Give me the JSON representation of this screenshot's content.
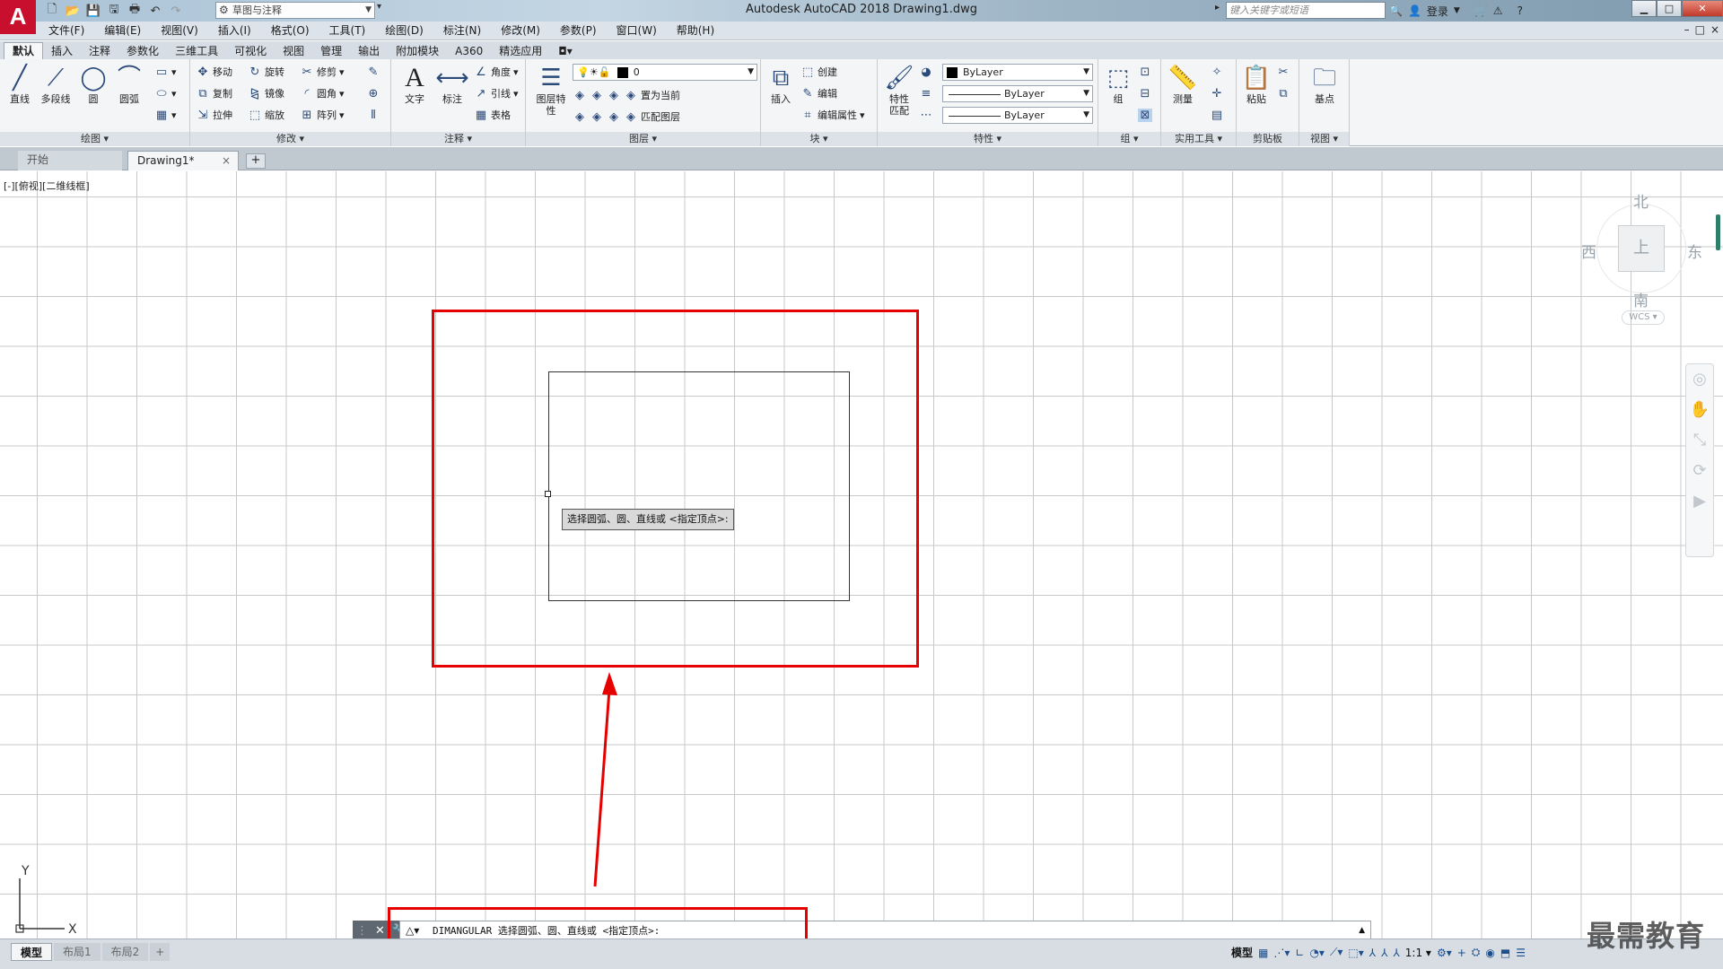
{
  "app": {
    "logo": "A",
    "title": "Autodesk AutoCAD 2018    Drawing1.dwg",
    "workspace": "草图与注释",
    "search_placeholder": "键入关键字或短语",
    "login": "登录",
    "doc_controls": [
      "–",
      "□",
      "×"
    ]
  },
  "menu": [
    "文件(F)",
    "编辑(E)",
    "视图(V)",
    "插入(I)",
    "格式(O)",
    "工具(T)",
    "绘图(D)",
    "标注(N)",
    "修改(M)",
    "参数(P)",
    "窗口(W)",
    "帮助(H)"
  ],
  "ribbon_tabs": [
    "默认",
    "插入",
    "注释",
    "参数化",
    "三维工具",
    "可视化",
    "视图",
    "管理",
    "输出",
    "附加模块",
    "A360",
    "精选应用"
  ],
  "ribbon": {
    "draw": {
      "title": "绘图 ▾",
      "line": "直线",
      "polyline": "多段线",
      "circle": "圆",
      "arc": "圆弧"
    },
    "modify": {
      "title": "修改 ▾",
      "move": "移动",
      "rotate": "旋转",
      "trim": "修剪",
      "copy": "复制",
      "mirror": "镜像",
      "fillet": "圆角",
      "stretch": "拉伸",
      "scale": "缩放",
      "array": "阵列"
    },
    "annotation": {
      "title": "注释 ▾",
      "text": "文字",
      "dimension": "标注",
      "angle": "角度",
      "leader": "引线",
      "table": "表格"
    },
    "layers": {
      "title": "图层 ▾",
      "properties": "图层特性",
      "current_layer": "0",
      "make_current": "置为当前",
      "match_layer": "匹配图层"
    },
    "block": {
      "title": "块 ▾",
      "insert": "插入",
      "create": "创建",
      "edit": "编辑",
      "edit_attr": "编辑属性"
    },
    "properties": {
      "title": "特性 ▾",
      "match": "特性匹配",
      "color": "ByLayer",
      "linetype": "ByLayer",
      "lineweight": "ByLayer"
    },
    "groups": {
      "title": "组 ▾",
      "group": "组"
    },
    "utilities": {
      "title": "实用工具 ▾",
      "measure": "测量"
    },
    "clipboard": {
      "title": "剪贴板",
      "paste": "粘贴"
    },
    "view": {
      "title": "视图 ▾",
      "base": "基点"
    }
  },
  "file_tabs": {
    "start": "开始",
    "drawing": "Drawing1*",
    "close": "×",
    "add": "+"
  },
  "canvas": {
    "viewport_label": "[-][俯视][二维线框]",
    "tooltip": "选择圆弧、圆、直线或 <指定顶点>:",
    "viewcube": {
      "north": "北",
      "south": "南",
      "east": "东",
      "west": "西",
      "face": "上",
      "wcs": "WCS ▾"
    },
    "ucs": {
      "x": "X",
      "y": "Y"
    }
  },
  "command": {
    "close": "✕",
    "text": "DIMANGULAR 选择圆弧、圆、直线或 <指定顶点>:"
  },
  "status": {
    "layouts": [
      "模型",
      "布局1",
      "布局2",
      "+"
    ],
    "model": "模型",
    "scale": "1:1 ▾",
    "watermark": "最需教育"
  },
  "colors": {
    "accent_red": "#e60000",
    "logo_red": "#c8102e"
  }
}
